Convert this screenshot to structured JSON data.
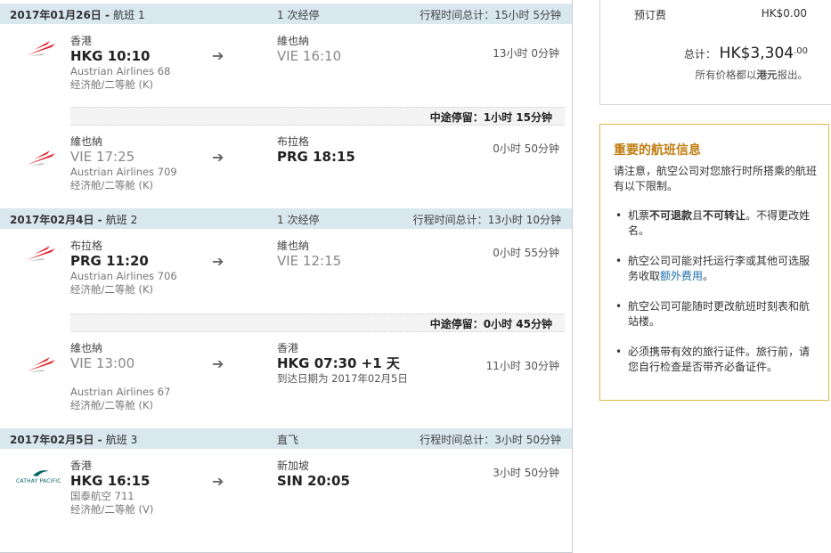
{
  "sections": [
    {
      "date": "2017年01月26日",
      "flight_label": "航班 1",
      "stops": "1 次经停",
      "total": "行程时间总计：15小时 5分钟"
    },
    {
      "date": "2017年02月4日",
      "flight_label": "航班 2",
      "stops": "1 次经停",
      "total": "行程时间总计：13小时 10分钟"
    },
    {
      "date": "2017年02月5日",
      "flight_label": "航班 3",
      "stops": "直飞",
      "total": "行程时间总计：3小时 50分钟"
    }
  ],
  "segments": [
    {
      "airline_icon": "austrian-airlines-logo",
      "from_city": "香港",
      "from_time": "HKG 10:10",
      "to_city": "維也納",
      "to_time": "VIE 16:10",
      "flight": "Austrian Airlines 68",
      "cabin": "经济舱/二等舱 (K)",
      "duration": "13小时 0分钟"
    },
    {
      "airline_icon": "austrian-airlines-logo",
      "from_city": "維也納",
      "from_time": "VIE 17:25",
      "to_city": "布拉格",
      "to_time": "PRG 18:15",
      "flight": "Austrian Airlines 709",
      "cabin": "经济舱/二等舱 (K)",
      "duration": "0小时 50分钟"
    },
    {
      "airline_icon": "austrian-airlines-logo",
      "from_city": "布拉格",
      "from_time": "PRG 11:20",
      "to_city": "維也納",
      "to_time": "VIE 12:15",
      "flight": "Austrian Airlines 706",
      "cabin": "经济舱/二等舱 (K)",
      "duration": "0小时 55分钟"
    },
    {
      "airline_icon": "austrian-airlines-logo",
      "from_city": "維也納",
      "from_time": "VIE 13:00",
      "to_city": "香港",
      "to_time": "HKG 07:30 +1 天",
      "arrival_note": "到达日期为 2017年02月5日",
      "flight": "Austrian Airlines 67",
      "cabin": "经济舱/二等舱 (K)",
      "duration": "11小时 30分钟"
    },
    {
      "airline_icon": "cathay-pacific-logo",
      "airline_logo_text": "CATHAY PACIFIC",
      "from_city": "香港",
      "from_time": "HKG 16:15",
      "to_city": "新加坡",
      "to_time": "SIN 20:05",
      "flight": "国泰航空 711",
      "cabin": "经济舱/二等舱 (V)",
      "duration": "3小时 50分钟"
    }
  ],
  "layovers": [
    {
      "label": "中途停留：",
      "duration": "1小时 15分钟"
    },
    {
      "label": "中途停留：",
      "duration": "0小时 45分钟"
    }
  ],
  "price": {
    "booking_fee_label": "预订费",
    "booking_fee_value": "HK$0.00",
    "total_label": "总计：",
    "total_value": "HK$3,304",
    "total_cents": ".00",
    "note_prefix": "所有价格都以",
    "note_currency": "港元",
    "note_suffix": "报出。"
  },
  "info": {
    "title": "重要的航班信息",
    "intro": "请注意，航空公司对您旅行时所搭乘的航班有以下限制。",
    "b1_pre": "机票",
    "b1_bold1": "不可退款",
    "b1_mid": "且",
    "b1_bold2": "不可转让",
    "b1_post": "。不得更改姓名。",
    "b2_pre": "航空公司可能对托运行李或其他可选服务收取",
    "b2_link": "额外费用",
    "b2_post": "。",
    "b3": "航空公司可能随时更改航班时刻表和航站楼。",
    "b4": "必须携带有效的旅行证件。旅行前，请您自行检查是否带齐必备证件。"
  },
  "colors": {
    "section_bg": "#d9e7ee",
    "austrian_red": "#e0262e",
    "cathay_green": "#006564",
    "info_border": "#e0b84a",
    "info_title": "#c07d12",
    "link": "#1a6ea8"
  }
}
